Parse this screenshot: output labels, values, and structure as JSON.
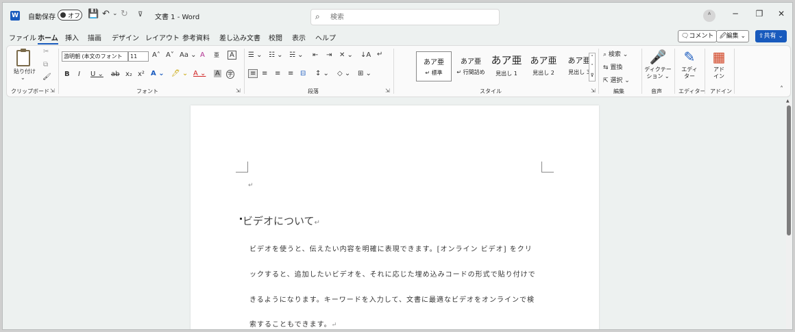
{
  "titlebar": {
    "app_letter": "W",
    "autosave_label": "自動保存",
    "autosave_state": "オフ",
    "save_icon": "💾",
    "undo_icon": "↶",
    "undo_arrow": "⌄",
    "redo_icon": "↻",
    "customize_icon": "⊽",
    "doc_title": "文書 1  -  Word",
    "search_icon": "⌕",
    "search_placeholder": "検索",
    "avatar": "ᴬ",
    "minimize": "─",
    "restore": "❐",
    "close": "✕"
  },
  "tabs": [
    {
      "label": "ファイル"
    },
    {
      "label": "ホーム"
    },
    {
      "label": "挿入"
    },
    {
      "label": "描画"
    },
    {
      "label": "デザイン"
    },
    {
      "label": "レイアウト"
    },
    {
      "label": "参考資料"
    },
    {
      "label": "差し込み文書"
    },
    {
      "label": "校閲"
    },
    {
      "label": "表示"
    },
    {
      "label": "ヘルプ"
    }
  ],
  "top_buttons": {
    "comment": "🗨コメント",
    "edit": "🖉編集 ⌄",
    "share": "⇪共有 ⌄"
  },
  "ribbon": {
    "clipboard": {
      "paste": "貼り付け",
      "paste_arrow": "⌄",
      "cut": "✂",
      "copy": "⧉",
      "format_painter": "🖌",
      "label": "クリップボード",
      "launcher": "⇲"
    },
    "font": {
      "font_name": "游明朝 (本文のフォント",
      "font_size": "11",
      "grow": "A˄",
      "shrink": "A˅",
      "case": "Aa ⌄",
      "clear": "A",
      "phonetic": "亜",
      "border_char": "A",
      "bold": "B",
      "italic": "I",
      "underline": "U ⌄",
      "strike": "ab",
      "subscript": "x₂",
      "superscript": "x²",
      "effects": "A ⌄",
      "highlight": "🖊 ⌄",
      "font_color": "A ⌄",
      "shading": "A",
      "enclosed": "字",
      "label": "フォント",
      "launcher": "⇲"
    },
    "paragraph": {
      "bullets": "☰ ⌄",
      "numbering": "☷ ⌄",
      "multilevel": "☵ ⌄",
      "decrease_indent": "⇤",
      "increase_indent": "⇥",
      "asian_layout": "✕ ⌄",
      "sort": "↓A",
      "marks": "↵",
      "align_left": "≡",
      "align_center": "≡",
      "align_right": "≡",
      "justify": "≡",
      "distributed": "⊟",
      "line_spacing": "↕ ⌄",
      "shading": "◇ ⌄",
      "borders": "⊞ ⌄",
      "label": "段落",
      "launcher": "⇲"
    },
    "styles": {
      "items": [
        {
          "preview": "あア亜",
          "name": "↵ 標準"
        },
        {
          "preview": "あア亜",
          "name": "↵ 行間詰め"
        },
        {
          "preview": "あア亜",
          "name": "見出し 1"
        },
        {
          "preview": "あア亜",
          "name": "見出し 2"
        },
        {
          "preview": "あア亜",
          "name": "見出し 3"
        }
      ],
      "scroll_up": "˄",
      "scroll_down": "˅",
      "more": "⊽",
      "label": "スタイル",
      "launcher": "⇲"
    },
    "editing": {
      "find": "⌕ 検索 ⌄",
      "replace": "⇆ 置換",
      "select": "⇱ 選択 ⌄",
      "label": "編集"
    },
    "voice": {
      "icon": "🎤",
      "dictate": "ディクテー\nション ⌄",
      "label": "音声"
    },
    "editor": {
      "icon": "✎",
      "name": "エディ\nター",
      "label": "エディター"
    },
    "addins": {
      "icon": "▦",
      "name": "アド\nイン",
      "label": "アドイン"
    },
    "collapse": "˄"
  },
  "document": {
    "empty_para_mark": "↵",
    "heading": "ビデオについて",
    "heading_mark": "↵",
    "body_lines": [
      "ビデオを使うと、伝えたい内容を明確に表現できます。[オンライン ビデオ] をクリ",
      "ックすると、追加したいビデオを、それに応じた埋め込みコードの形式で貼り付けで",
      "きるようになります。キーワードを入力して、文書に最適なビデオをオンラインで検",
      "索することもできます。"
    ],
    "body_end_mark": "↵"
  },
  "colors": {
    "accent": "#185abd",
    "frame_bg": "#edf1f0",
    "page_bg": "#ffffff"
  }
}
